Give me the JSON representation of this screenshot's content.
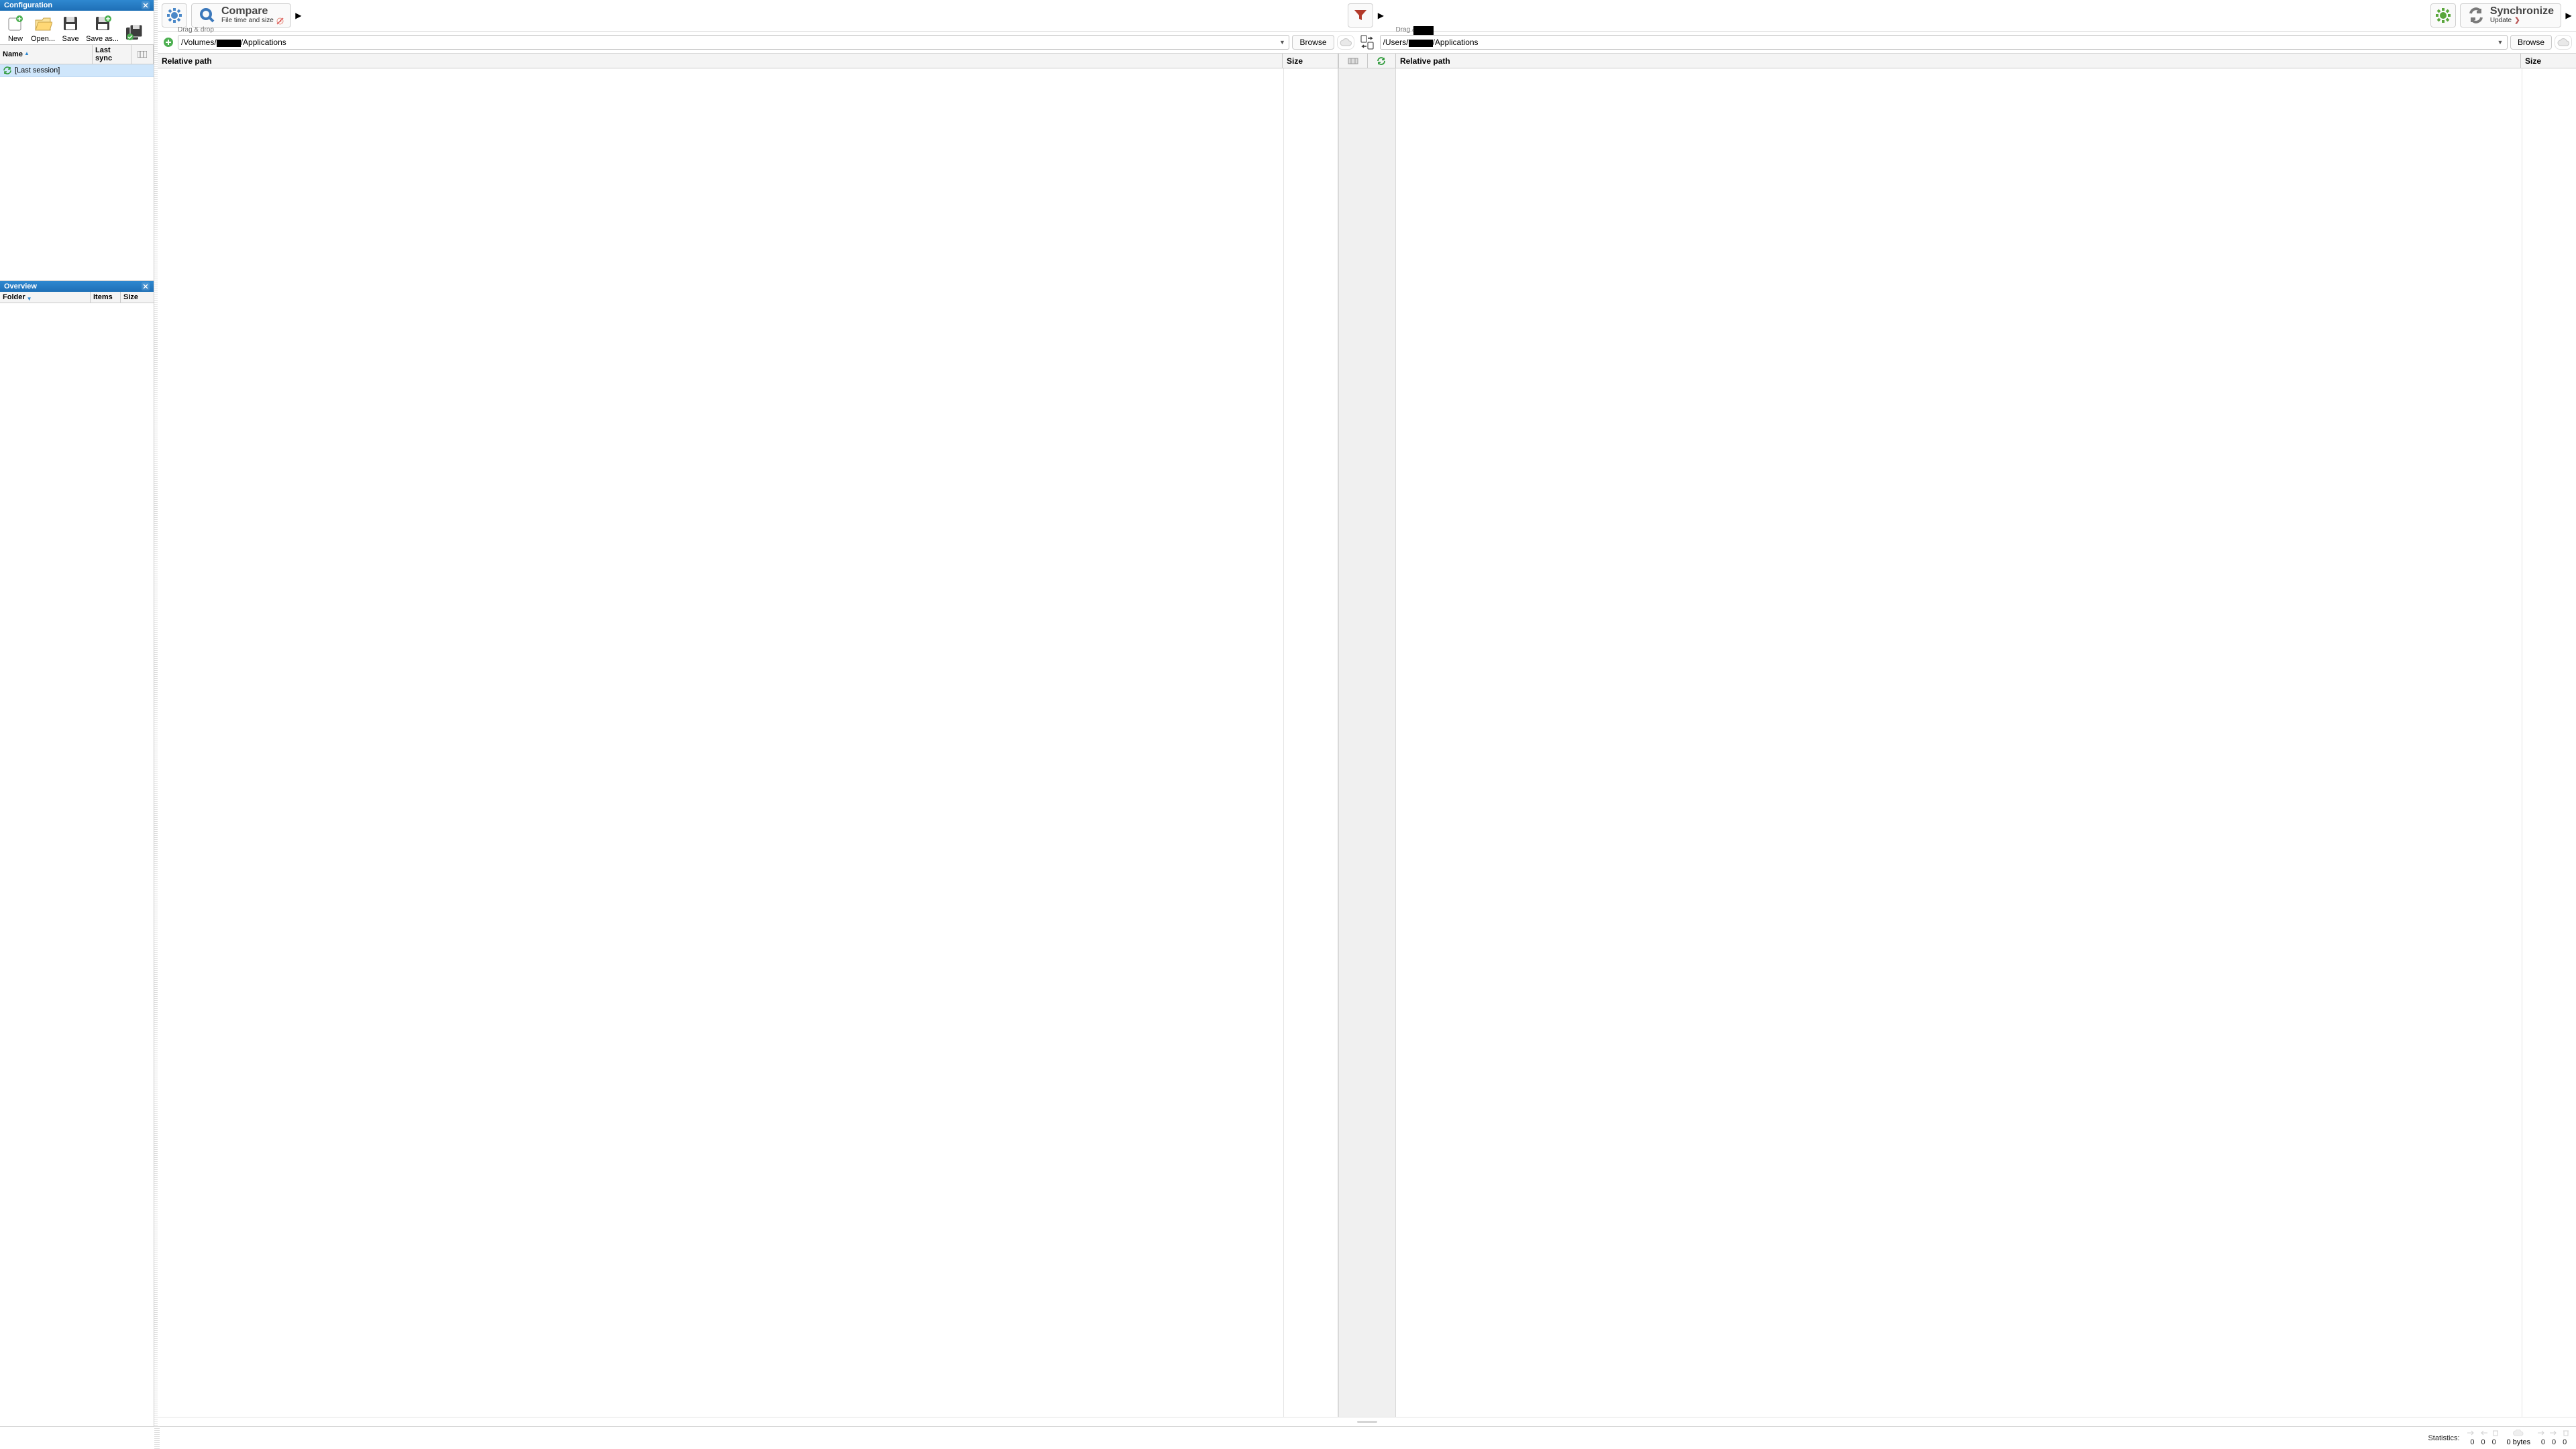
{
  "sidebar": {
    "config_title": "Configuration",
    "overview_title": "Overview",
    "buttons": {
      "new": "New",
      "open": "Open...",
      "save": "Save",
      "saveas": "Save as..."
    },
    "columns": {
      "name": "Name",
      "last_sync": "Last sync"
    },
    "rows": [
      {
        "label": "[Last session]"
      }
    ],
    "overview_columns": {
      "folder": "Folder",
      "items": "Items",
      "size": "Size"
    }
  },
  "toolbar": {
    "compare": {
      "title": "Compare",
      "sub": "File time and size"
    },
    "sync": {
      "title": "Synchronize",
      "sub": "Update"
    }
  },
  "pair": {
    "hint": "Drag & drop",
    "left_path_prefix": "/Volumes/",
    "left_path_suffix": "/Applications",
    "right_path_prefix": "/Users/",
    "right_path_suffix": "/Applications",
    "browse": "Browse"
  },
  "columns": {
    "relpath": "Relative path",
    "size": "Size"
  },
  "status": {
    "label": "Statistics:",
    "left": {
      "a": "0",
      "b": "0",
      "c": "0"
    },
    "bytes": "0 bytes",
    "right": {
      "a": "0",
      "b": "0",
      "c": "0"
    }
  }
}
